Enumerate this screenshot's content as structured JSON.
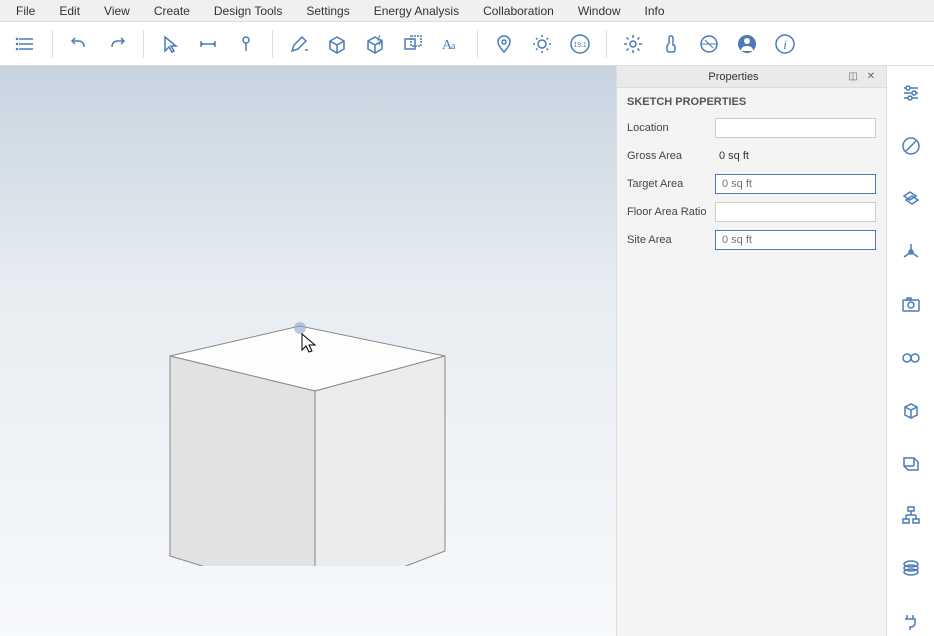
{
  "menubar": {
    "items": [
      "File",
      "Edit",
      "View",
      "Create",
      "Design Tools",
      "Settings",
      "Energy Analysis",
      "Collaboration",
      "Window",
      "Info"
    ]
  },
  "toolbar": {
    "version_badge": "19.1"
  },
  "properties": {
    "panel_title": "Properties",
    "section_title": "SKETCH PROPERTIES",
    "rows": {
      "location": {
        "label": "Location",
        "value": ""
      },
      "gross_area": {
        "label": "Gross Area",
        "value": "0 sq ft"
      },
      "target_area": {
        "label": "Target Area",
        "placeholder": "0 sq ft",
        "value": ""
      },
      "floor_area_ratio": {
        "label": "Floor Area Ratio",
        "value": ""
      },
      "site_area": {
        "label": "Site Area",
        "placeholder": "0 sq ft",
        "value": ""
      }
    }
  }
}
